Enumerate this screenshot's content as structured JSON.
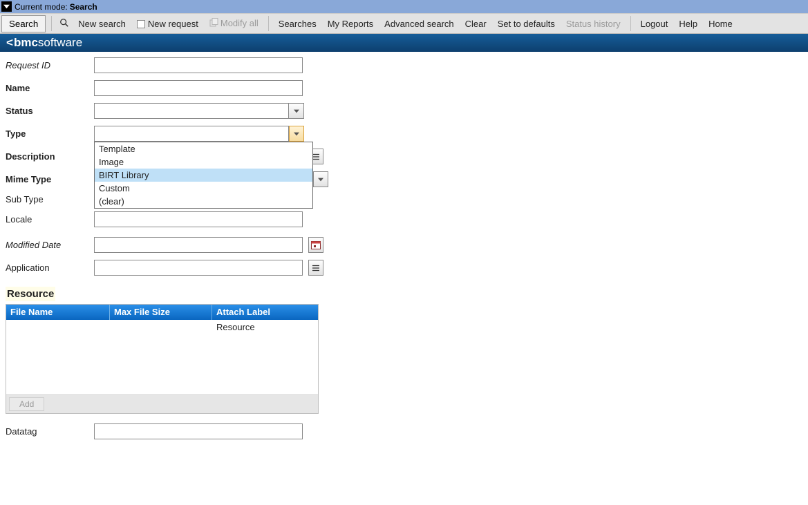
{
  "mode_bar": {
    "prefix": "Current mode:",
    "mode": "Search"
  },
  "toolbar": {
    "search_btn": "Search",
    "new_search": "New search",
    "new_request": "New request",
    "modify_all": "Modify all",
    "searches": "Searches",
    "my_reports": "My Reports",
    "advanced_search": "Advanced search",
    "clear": "Clear",
    "set_defaults": "Set to defaults",
    "status_history": "Status history",
    "logout": "Logout",
    "help": "Help",
    "home": "Home"
  },
  "brand": {
    "prefix": "bmc",
    "suffix": "software"
  },
  "form": {
    "request_id": {
      "label": "Request ID",
      "value": ""
    },
    "name": {
      "label": "Name",
      "value": ""
    },
    "status": {
      "label": "Status",
      "value": ""
    },
    "type": {
      "label": "Type",
      "value": "",
      "options": [
        "Template",
        "Image",
        "BIRT Library",
        "Custom",
        "(clear)"
      ],
      "highlighted_index": 2
    },
    "description": {
      "label": "Description",
      "value": ""
    },
    "mime_type": {
      "label": "Mime Type",
      "value": ""
    },
    "sub_type": {
      "label": "Sub Type",
      "value": ""
    },
    "locale": {
      "label": "Locale",
      "value": ""
    },
    "modified_date": {
      "label": "Modified Date",
      "value": ""
    },
    "application": {
      "label": "Application",
      "value": ""
    },
    "datatag": {
      "label": "Datatag",
      "value": ""
    }
  },
  "resource": {
    "title": "Resource",
    "columns": [
      "File Name",
      "Max File Size",
      "Attach Label"
    ],
    "rows": [
      {
        "file_name": "",
        "max_file_size": "",
        "attach_label": "Resource"
      }
    ],
    "add_btn": "Add"
  }
}
